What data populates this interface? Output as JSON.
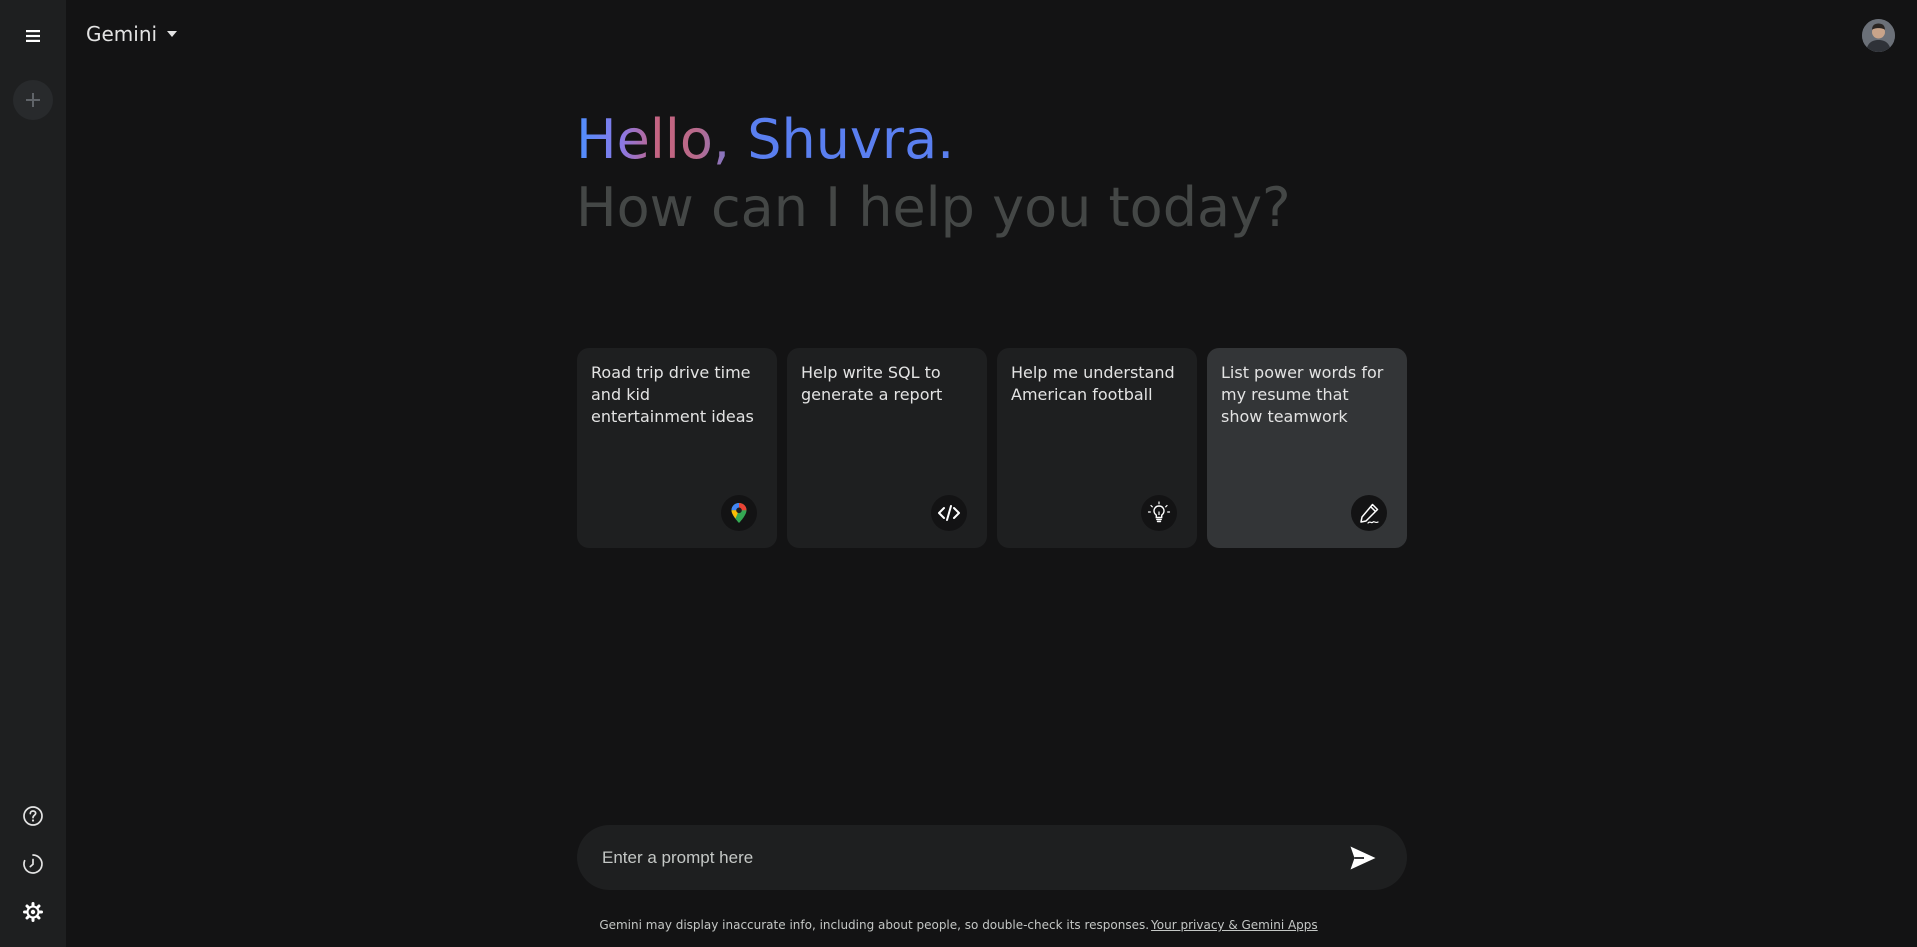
{
  "header": {
    "app_title": "Gemini"
  },
  "sidebar": {
    "menu_icon": "menu-icon",
    "new_chat_icon": "plus-icon",
    "help_icon": "help-icon",
    "activity_icon": "history-icon",
    "settings_icon": "gear-icon"
  },
  "main": {
    "greeting": "Hello, Shuvra.",
    "subtitle": "How can I help you today?",
    "cards": [
      {
        "text": "Road trip drive time and kid entertainment ideas",
        "icon": "maps-pin-icon"
      },
      {
        "text": "Help write SQL to generate a report",
        "icon": "code-icon"
      },
      {
        "text": "Help me understand American football",
        "icon": "lightbulb-icon"
      },
      {
        "text": "List power words for my resume that show teamwork",
        "icon": "pen-icon"
      }
    ]
  },
  "prompt": {
    "placeholder": "Enter a prompt here",
    "value": ""
  },
  "footer": {
    "disclaimer": "Gemini may display inaccurate info, including about people, so double-check its responses.",
    "privacy_link": "Your privacy & Gemini Apps"
  }
}
